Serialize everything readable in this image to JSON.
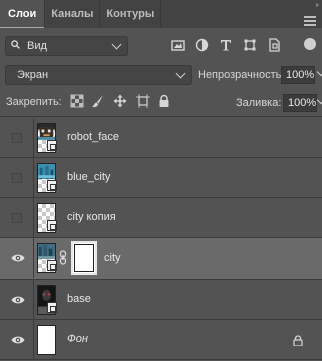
{
  "tabs": [
    {
      "label": "Слои",
      "active": true
    },
    {
      "label": "Каналы",
      "active": false
    },
    {
      "label": "Контуры",
      "active": false
    }
  ],
  "filter": {
    "selected": "Вид",
    "icons": [
      "image-filter-icon",
      "adjustment-filter-icon",
      "type-filter-icon",
      "shape-filter-icon",
      "smart-object-filter-icon"
    ]
  },
  "blend": {
    "mode": "Экран",
    "opacity_label": "Непрозрачность:",
    "opacity_value": "100%"
  },
  "lock": {
    "label": "Закрепить:",
    "icons": [
      "lock-transparent-pixels-icon",
      "lock-image-pixels-icon",
      "lock-position-icon",
      "lock-artboard-icon",
      "lock-all-icon"
    ],
    "fill_label": "Заливка:",
    "fill_value": "100%"
  },
  "layers": [
    {
      "name": "robot_face",
      "visible": false,
      "selected": false,
      "smart_object": true,
      "mask": false,
      "locked": false,
      "italic": false,
      "thumb": "robot"
    },
    {
      "name": "blue_city",
      "visible": false,
      "selected": false,
      "smart_object": true,
      "mask": false,
      "locked": false,
      "italic": false,
      "thumb": "city-blue"
    },
    {
      "name": "city копия",
      "visible": false,
      "selected": false,
      "smart_object": true,
      "mask": false,
      "locked": false,
      "italic": false,
      "thumb": "transparent"
    },
    {
      "name": "city",
      "visible": true,
      "selected": true,
      "smart_object": true,
      "mask": true,
      "locked": false,
      "italic": false,
      "thumb": "city"
    },
    {
      "name": "base",
      "visible": true,
      "selected": false,
      "smart_object": true,
      "mask": false,
      "locked": false,
      "italic": false,
      "thumb": "dark"
    },
    {
      "name": "Фон",
      "visible": true,
      "selected": false,
      "smart_object": false,
      "mask": false,
      "locked": true,
      "italic": true,
      "thumb": "white"
    }
  ],
  "colors": {
    "panel": "#535353",
    "tab_bar": "#434343",
    "selected_row": "#6a6a6a",
    "text": "#e6e6e6"
  }
}
